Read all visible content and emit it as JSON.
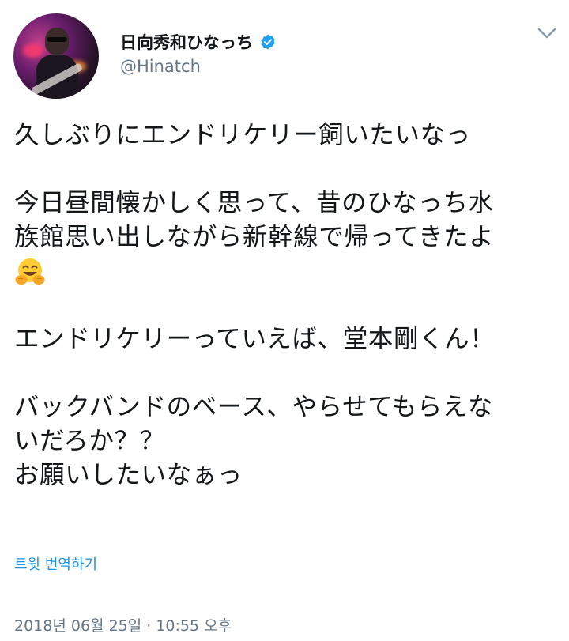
{
  "author": {
    "display_name": "日向秀和ひなっち",
    "handle": "@Hinatch",
    "verified": true
  },
  "tweet": {
    "lines": [
      "久しぶりにエンドリケリー飼いたいなっ",
      "",
      "今日昼間懐かしく思って、昔のひなっち水",
      "族館思い出しながら新幹線で帰ってきたよ",
      "",
      "エンドリケリーっていえば、堂本剛くん！",
      "",
      "バックバンドのベース、やらせてもらえな",
      "いだろか？？",
      "お願いしたいなぁっ"
    ],
    "emoji": "hugging-face"
  },
  "translate_label": "트윗 번역하기",
  "timestamp": "2018년 06월 25일 · 10:55 오후",
  "colors": {
    "accent": "#1b95e0",
    "verified": "#1da1f2",
    "secondary_text": "#657786",
    "primary_text": "#14171a"
  },
  "icons": {
    "verified": "verified-badge-icon",
    "menu": "chevron-down-icon",
    "emoji": "hugging-face-emoji"
  }
}
